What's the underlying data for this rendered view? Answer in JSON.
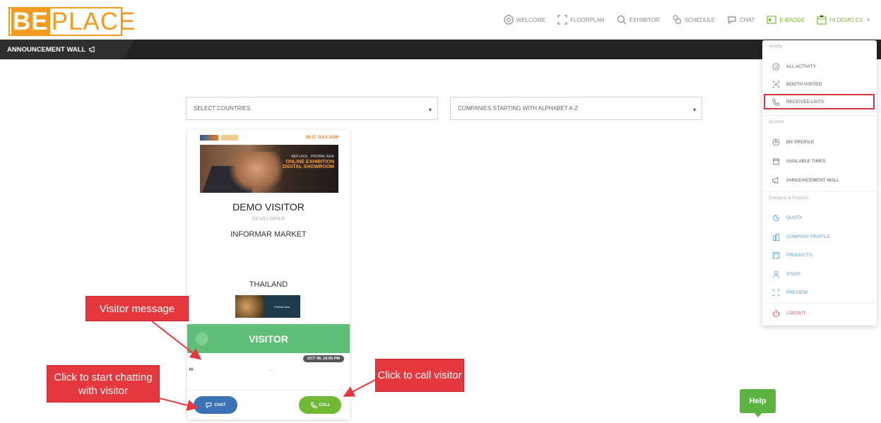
{
  "logo": {
    "be": "BE",
    "place": "PLACE"
  },
  "topnav": [
    {
      "label": "WELCOME",
      "icon": "welcome-icon",
      "color": "#888888"
    },
    {
      "label": "FLOORPLAN",
      "icon": "floorplan-icon",
      "color": "#888888"
    },
    {
      "label": "EXHIBITOR",
      "icon": "search-icon",
      "color": "#888888"
    },
    {
      "label": "SCHEDULE",
      "icon": "schedule-icon",
      "color": "#888888"
    },
    {
      "label": "CHAT",
      "icon": "chat-icon",
      "color": "#888888"
    },
    {
      "label": "E-BADGE",
      "icon": "badge-icon",
      "color": "#7bbf3a"
    },
    {
      "label": "HI DEMO EX",
      "icon": "store-icon",
      "color": "#7bbf3a"
    }
  ],
  "announcement": {
    "label": "ANNOUNCEMENT WALL"
  },
  "filters": {
    "countries": "SELECT COUNTRIES",
    "alphabet": "COMPANIES STARTING WITH ALPHABET A-Z"
  },
  "card": {
    "banner_date": "15-17 JULY 2020",
    "banner_line1": "BEPLACE · PROPAK ASIA",
    "banner_line2": "ONLINE EXHIBITION",
    "banner_line3": "DIGITAL SHOWROOM",
    "name": "DEMO VISITOR",
    "role": "DEVELOPER",
    "company": "INFORMAR MARKET",
    "country": "THAILAND",
    "small_banner_text": "ProPak Asia",
    "type_label": "VISITOR",
    "time": "OCT 08, 16:05 PM",
    "quote": "“",
    "message": "–",
    "chat_label": "CHAT",
    "call_label": "CALL"
  },
  "menu": {
    "activity_title": "Activity",
    "account_title": "Account",
    "company_title": "Company & Products",
    "items": [
      {
        "label": "ALL ACTIVITY",
        "icon": "activity-icon"
      },
      {
        "label": "BOOTH VISITED",
        "icon": "booth-icon"
      },
      {
        "label": "RECEIVED LISTS",
        "icon": "call-list-icon"
      },
      {
        "label": "MY PROFILE",
        "icon": "profile-icon"
      },
      {
        "label": "AVAILABLE TIMES",
        "icon": "calendar-icon"
      },
      {
        "label": "ANNOUNCEMENT WALL",
        "icon": "megaphone-icon"
      },
      {
        "label": "QUOTA",
        "icon": "quota-icon"
      },
      {
        "label": "COMPANY PROFILE",
        "icon": "company-icon"
      },
      {
        "label": "PRODUCTS",
        "icon": "products-icon"
      },
      {
        "label": "STAFF",
        "icon": "staff-icon"
      },
      {
        "label": "PREVIEW",
        "icon": "preview-icon"
      },
      {
        "label": "LOGOUT",
        "icon": "logout-icon"
      }
    ]
  },
  "callouts": {
    "message": "Visitor message",
    "chat": "Click to start chatting with visitor",
    "call": "Click to call visitor"
  },
  "help": "Help",
  "colors": {
    "accent": "#f39a22",
    "green": "#5fbf79",
    "blue": "#3b72b3",
    "red": "#e5383e"
  }
}
